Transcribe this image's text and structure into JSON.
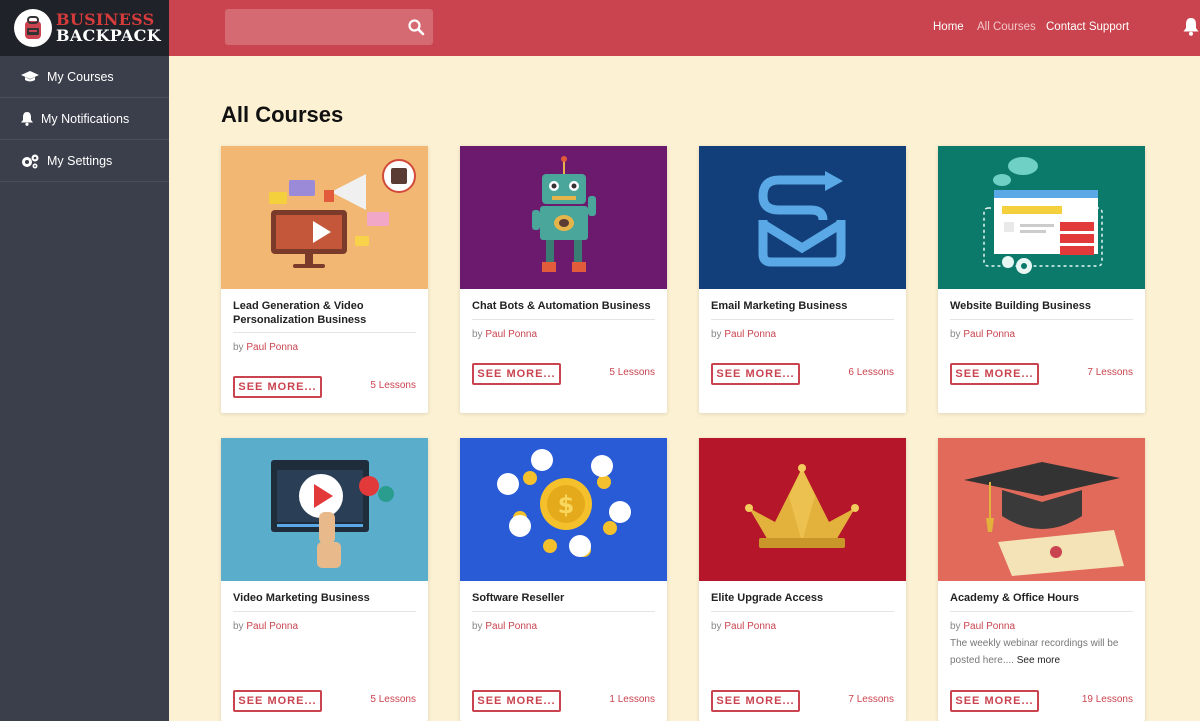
{
  "brand": {
    "line1": "BUSINESS",
    "line2": "BACKPACK"
  },
  "sidebar": {
    "items": [
      {
        "label": "My Courses",
        "icon": "graduation-cap-icon"
      },
      {
        "label": "My Notifications",
        "icon": "bell-icon"
      },
      {
        "label": "My Settings",
        "icon": "gears-icon"
      }
    ]
  },
  "header": {
    "search": {
      "placeholder": "",
      "icon": "search-icon"
    },
    "nav": [
      {
        "label": "Home"
      },
      {
        "label": "All Courses"
      },
      {
        "label": "Contact Support"
      }
    ],
    "notification_icon": "bell-icon"
  },
  "main": {
    "title": "All Courses",
    "courses": [
      {
        "title": "Lead Generation & Video Personalization Business",
        "author_prefix": "by",
        "author": "Paul Ponna",
        "button": "SEE MORE...",
        "lessons": "5 Lessons",
        "image": "megaphone-video-illustration",
        "bg": "#f2b772"
      },
      {
        "title": "Chat Bots & Automation Business",
        "author_prefix": "by",
        "author": "Paul Ponna",
        "button": "SEE MORE...",
        "lessons": "5 Lessons",
        "image": "robot-illustration",
        "bg": "#6c1a6e"
      },
      {
        "title": "Email Marketing Business",
        "author_prefix": "by",
        "author": "Paul Ponna",
        "button": "SEE MORE...",
        "lessons": "6 Lessons",
        "image": "email-send-logo",
        "bg": "#123f7a"
      },
      {
        "title": "Website Building Business",
        "author_prefix": "by",
        "author": "Paul Ponna",
        "button": "SEE MORE...",
        "lessons": "7 Lessons",
        "image": "website-domains-illustration",
        "bg": "#0b7a6a"
      },
      {
        "title": "Video Marketing Business",
        "author_prefix": "by",
        "author": "Paul Ponna",
        "button": "SEE MORE...",
        "lessons": "5 Lessons",
        "image": "video-player-illustration",
        "bg": "#5aaecc"
      },
      {
        "title": "Software Reseller",
        "author_prefix": "by",
        "author": "Paul Ponna",
        "button": "SEE MORE...",
        "lessons": "1 Lessons",
        "image": "dollar-coins-illustration",
        "bg": "#2a5bd6"
      },
      {
        "title": "Elite Upgrade Access",
        "author_prefix": "by",
        "author": "Paul Ponna",
        "button": "SEE MORE...",
        "lessons": "7 Lessons",
        "image": "crown-illustration",
        "bg": "#b5162a"
      },
      {
        "title": "Academy & Office Hours",
        "author_prefix": "by",
        "author": "Paul Ponna",
        "description": "The weekly webinar recordings will be posted here....",
        "see_more_link": "See more",
        "button": "SEE MORE...",
        "lessons": "19 Lessons",
        "image": "graduation-cap-diploma-illustration",
        "bg": "#e26a5a"
      }
    ]
  },
  "colors": {
    "accent": "#c9444f",
    "sidebar": "#3b3f4b",
    "page_bg": "#fdf1d3"
  }
}
